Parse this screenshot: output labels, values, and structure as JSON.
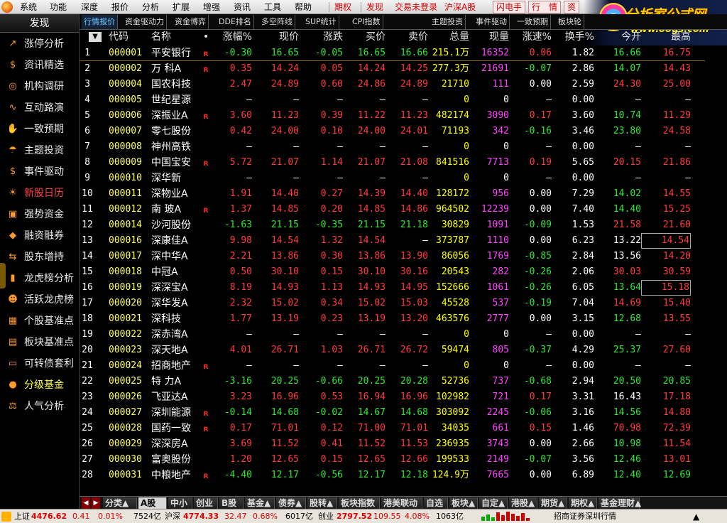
{
  "menubar": {
    "items": [
      "系统",
      "功能",
      "深度",
      "报价",
      "分析",
      "扩展",
      "增强",
      "资讯",
      "工具",
      "帮助"
    ],
    "quick": [
      "期权",
      "发现"
    ],
    "login": "交易未登录",
    "hs": "沪深A股",
    "btns": [
      "闪电手",
      "行　情",
      "资"
    ]
  },
  "brand": {
    "title": "分析家公式网",
    "url": "www.88gs.com"
  },
  "sidebar": {
    "header": "发现",
    "items": [
      {
        "label": "涨停分析",
        "icon": "chart-up-icon"
      },
      {
        "label": "资讯精选",
        "icon": "dollar-icon"
      },
      {
        "label": "机构调研",
        "icon": "target-icon"
      },
      {
        "label": "互动路演",
        "icon": "line-chart-icon"
      },
      {
        "label": "一致预期",
        "icon": "handshake-icon"
      },
      {
        "label": "主题投资",
        "icon": "umbrella-icon"
      },
      {
        "label": "事件驱动",
        "icon": "money-bag-icon"
      },
      {
        "label": "新股日历",
        "icon": "bulb-icon"
      },
      {
        "label": "强势资金",
        "icon": "briefcase-icon"
      },
      {
        "label": "融资融券",
        "icon": "car-icon"
      },
      {
        "label": "股东增持",
        "icon": "swap-icon"
      },
      {
        "label": "龙虎榜分析",
        "icon": "bar-chart-icon"
      },
      {
        "label": "活跃龙虎榜",
        "icon": "people-icon"
      },
      {
        "label": "个股基准点",
        "icon": "calc-icon"
      },
      {
        "label": "板块基准点",
        "icon": "grid-icon"
      },
      {
        "label": "可转债套利",
        "icon": "wallet-icon"
      },
      {
        "label": "分级基金",
        "icon": "piggy-icon"
      },
      {
        "label": "人气分析",
        "icon": "scale-icon"
      }
    ]
  },
  "tabs": [
    "行情报价",
    "资金驱动力",
    "资金博弈",
    "DDE排名",
    "多空阵线",
    "SUP统计",
    "CPI指数",
    "主题投资",
    "事件驱动",
    "一致预期",
    "板块轮"
  ],
  "columns": [
    "代码",
    "名称",
    "•",
    "涨幅%",
    "现价",
    "涨跌",
    "买价",
    "卖价",
    "总量",
    "现量",
    "涨速%",
    "换手%",
    "今开",
    "最高"
  ],
  "rows": [
    [
      "1",
      "000001",
      "平安银行",
      "R",
      "-0.30",
      "16.65",
      "-0.05",
      "16.65",
      "16.66",
      "215.1万",
      "16352",
      "0.06",
      "1.82",
      "16.66",
      "16.75"
    ],
    [
      "2",
      "000002",
      "万 科A",
      "R",
      "0.35",
      "14.24",
      "0.05",
      "14.24",
      "14.25",
      "277.3万",
      "21691",
      "-0.07",
      "2.86",
      "14.07",
      "14.43"
    ],
    [
      "3",
      "000004",
      "国农科技",
      "",
      "2.47",
      "24.89",
      "0.60",
      "24.86",
      "24.89",
      "21710",
      "111",
      "0.00",
      "2.59",
      "24.30",
      "25.00"
    ],
    [
      "4",
      "000005",
      "世纪星源",
      "",
      "—",
      "—",
      "—",
      "—",
      "—",
      "0",
      "0",
      "—",
      "0.00",
      "—",
      "—"
    ],
    [
      "5",
      "000006",
      "深振业A",
      "R",
      "3.60",
      "11.23",
      "0.39",
      "11.22",
      "11.23",
      "482174",
      "3090",
      "0.17",
      "3.60",
      "10.74",
      "11.29"
    ],
    [
      "6",
      "000007",
      "零七股份",
      "",
      "0.42",
      "24.00",
      "0.10",
      "24.00",
      "24.01",
      "71193",
      "342",
      "-0.16",
      "3.46",
      "23.80",
      "24.58"
    ],
    [
      "7",
      "000008",
      "神州高铁",
      "",
      "—",
      "—",
      "—",
      "—",
      "—",
      "0",
      "0",
      "—",
      "0.00",
      "—",
      "—"
    ],
    [
      "8",
      "000009",
      "中国宝安",
      "R",
      "5.72",
      "21.07",
      "1.14",
      "21.07",
      "21.08",
      "841516",
      "7713",
      "0.19",
      "5.65",
      "20.15",
      "21.86"
    ],
    [
      "9",
      "000010",
      "深华新",
      "",
      "—",
      "—",
      "—",
      "—",
      "—",
      "0",
      "0",
      "—",
      "0.00",
      "—",
      "—"
    ],
    [
      "10",
      "000011",
      "深物业A",
      "",
      "1.91",
      "14.40",
      "0.27",
      "14.39",
      "14.40",
      "128172",
      "956",
      "0.00",
      "7.29",
      "14.02",
      "14.55"
    ],
    [
      "11",
      "000012",
      "南 玻A",
      "R",
      "1.37",
      "14.85",
      "0.20",
      "14.85",
      "14.86",
      "964502",
      "12239",
      "0.00",
      "7.40",
      "14.40",
      "15.25"
    ],
    [
      "12",
      "000014",
      "沙河股份",
      "",
      "-1.63",
      "21.15",
      "-0.35",
      "21.15",
      "21.18",
      "30829",
      "1091",
      "-0.09",
      "1.53",
      "21.58",
      "21.60"
    ],
    [
      "13",
      "000016",
      "深康佳A",
      "",
      "9.98",
      "14.54",
      "1.32",
      "14.54",
      "—",
      "373787",
      "1110",
      "0.00",
      "6.23",
      "13.22",
      "14.54"
    ],
    [
      "14",
      "000017",
      "深中华A",
      "",
      "2.21",
      "13.86",
      "0.30",
      "13.86",
      "13.90",
      "86056",
      "1769",
      "-0.85",
      "2.84",
      "13.56",
      "14.20"
    ],
    [
      "15",
      "000018",
      "中冠A",
      "",
      "0.50",
      "30.10",
      "0.15",
      "30.10",
      "30.16",
      "20543",
      "282",
      "-0.26",
      "2.06",
      "30.03",
      "30.59"
    ],
    [
      "16",
      "000019",
      "深深宝A",
      "",
      "8.19",
      "14.93",
      "1.13",
      "14.93",
      "14.95",
      "152666",
      "1061",
      "-0.26",
      "6.05",
      "13.64",
      "15.18"
    ],
    [
      "17",
      "000020",
      "深华发A",
      "",
      "2.32",
      "15.02",
      "0.34",
      "15.02",
      "15.03",
      "45528",
      "537",
      "-0.19",
      "7.04",
      "14.69",
      "15.40"
    ],
    [
      "18",
      "000021",
      "深科技",
      "",
      "1.77",
      "13.19",
      "0.23",
      "13.19",
      "13.20",
      "463576",
      "2777",
      "0.00",
      "3.15",
      "12.68",
      "13.55"
    ],
    [
      "19",
      "000022",
      "深赤湾A",
      "",
      "—",
      "—",
      "—",
      "—",
      "—",
      "0",
      "0",
      "—",
      "0.00",
      "—",
      "—"
    ],
    [
      "20",
      "000023",
      "深天地A",
      "",
      "4.01",
      "26.71",
      "1.03",
      "26.71",
      "26.72",
      "59474",
      "805",
      "-0.37",
      "4.29",
      "25.37",
      "27.60"
    ],
    [
      "21",
      "000024",
      "招商地产",
      "R",
      "—",
      "—",
      "—",
      "—",
      "—",
      "0",
      "0",
      "—",
      "0.00",
      "—",
      "—"
    ],
    [
      "22",
      "000025",
      "特 力A",
      "",
      "-3.16",
      "20.25",
      "-0.66",
      "20.25",
      "20.28",
      "52736",
      "737",
      "-0.68",
      "2.94",
      "20.50",
      "20.85"
    ],
    [
      "23",
      "000026",
      "飞亚达A",
      "",
      "3.23",
      "16.96",
      "0.53",
      "16.94",
      "16.96",
      "102982",
      "721",
      "0.17",
      "3.31",
      "16.43",
      "17.18"
    ],
    [
      "24",
      "000027",
      "深圳能源",
      "R",
      "-0.14",
      "14.68",
      "-0.02",
      "14.67",
      "14.68",
      "303092",
      "2245",
      "-0.06",
      "3.16",
      "14.56",
      "14.80"
    ],
    [
      "25",
      "000028",
      "国药一致",
      "R",
      "0.17",
      "71.01",
      "0.12",
      "71.00",
      "71.01",
      "34035",
      "661",
      "0.15",
      "1.46",
      "70.98",
      "72.39"
    ],
    [
      "26",
      "000029",
      "深深房A",
      "",
      "3.69",
      "11.52",
      "0.41",
      "11.52",
      "11.53",
      "236935",
      "3743",
      "0.00",
      "2.66",
      "10.98",
      "11.54"
    ],
    [
      "27",
      "000030",
      "富奥股份",
      "",
      "1.20",
      "12.65",
      "0.15",
      "12.65",
      "12.66",
      "199533",
      "2149",
      "-0.07",
      "3.56",
      "12.46",
      "13.01"
    ],
    [
      "28",
      "000031",
      "中粮地产",
      "R",
      "-4.40",
      "12.17",
      "-0.56",
      "12.17",
      "12.18",
      "124.9万",
      "7665",
      "0.00",
      "6.89",
      "12.40",
      "12.69"
    ]
  ],
  "boardtabs": [
    "分类▲",
    "A股",
    "中小",
    "创业",
    "B股",
    "基金▲",
    "债券▲",
    "股转▲",
    "板块指数",
    "港美联动",
    "自选",
    "板块▲",
    "自定▲",
    "港股▲",
    "期货▲",
    "期权▲",
    "基金理财▲"
  ],
  "status": {
    "sh_label": "上证",
    "sh_index": "4476.62",
    "sh_chg": "0.41",
    "sh_pct": "0.01%",
    "sh_amt": "7524亿",
    "hs_label": "沪深",
    "hs_index": "4774.33",
    "hs_chg": "32.47",
    "hs_pct": "0.68%",
    "hs_amt": "6017亿",
    "cy_label": "创业",
    "cy_index": "2797.52",
    "cy_chg": "109.55",
    "cy_pct": "4.08%",
    "cy_amt": "1063亿",
    "broker": "招商证券深圳行情"
  },
  "colors": {
    "up": "#ff3c3c",
    "down": "#33e633",
    "code": "#ffff66",
    "volume": "#ff44ff"
  }
}
